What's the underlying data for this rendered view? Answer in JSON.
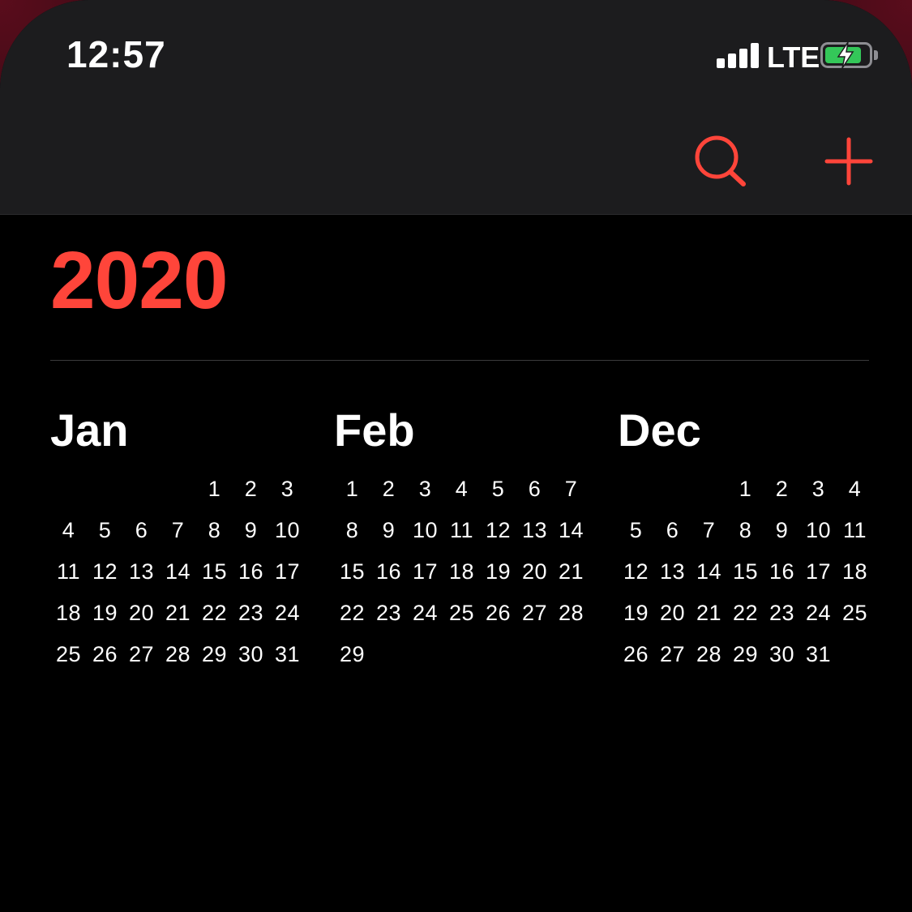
{
  "status_bar": {
    "time": "12:57",
    "carrier": "LTE",
    "signal_bars": 4,
    "battery_level": 0.85,
    "battery_charging": true
  },
  "toolbar": {
    "search_icon": "search-icon",
    "add_icon": "plus-icon"
  },
  "year": "2020",
  "colors": {
    "accent": "#ff453a",
    "header_bg": "#1c1c1e",
    "background": "#000000",
    "text": "#ffffff",
    "battery_fill": "#34c759"
  },
  "months": [
    {
      "name": "Jan",
      "days": [
        [
          "",
          "",
          "",
          "",
          "1",
          "2",
          "3"
        ],
        [
          "4",
          "5",
          "6",
          "7",
          "8",
          "9",
          "10"
        ],
        [
          "11",
          "12",
          "13",
          "14",
          "15",
          "16",
          "17"
        ],
        [
          "18",
          "19",
          "20",
          "21",
          "22",
          "23",
          "24"
        ],
        [
          "25",
          "26",
          "27",
          "28",
          "29",
          "30",
          "31"
        ]
      ]
    },
    {
      "name": "Feb",
      "days": [
        [
          "1",
          "2",
          "3",
          "4",
          "5",
          "6",
          "7"
        ],
        [
          "8",
          "9",
          "10",
          "11",
          "12",
          "13",
          "14"
        ],
        [
          "15",
          "16",
          "17",
          "18",
          "19",
          "20",
          "21"
        ],
        [
          "22",
          "23",
          "24",
          "25",
          "26",
          "27",
          "28"
        ],
        [
          "29",
          "",
          "",
          "",
          "",
          "",
          ""
        ]
      ]
    },
    {
      "name": "Dec",
      "days": [
        [
          "",
          "",
          "",
          "1",
          "2",
          "3",
          "4"
        ],
        [
          "5",
          "6",
          "7",
          "8",
          "9",
          "10",
          "11"
        ],
        [
          "12",
          "13",
          "14",
          "15",
          "16",
          "17",
          "18"
        ],
        [
          "19",
          "20",
          "21",
          "22",
          "23",
          "24",
          "25"
        ],
        [
          "26",
          "27",
          "28",
          "29",
          "30",
          "31",
          ""
        ]
      ]
    }
  ]
}
